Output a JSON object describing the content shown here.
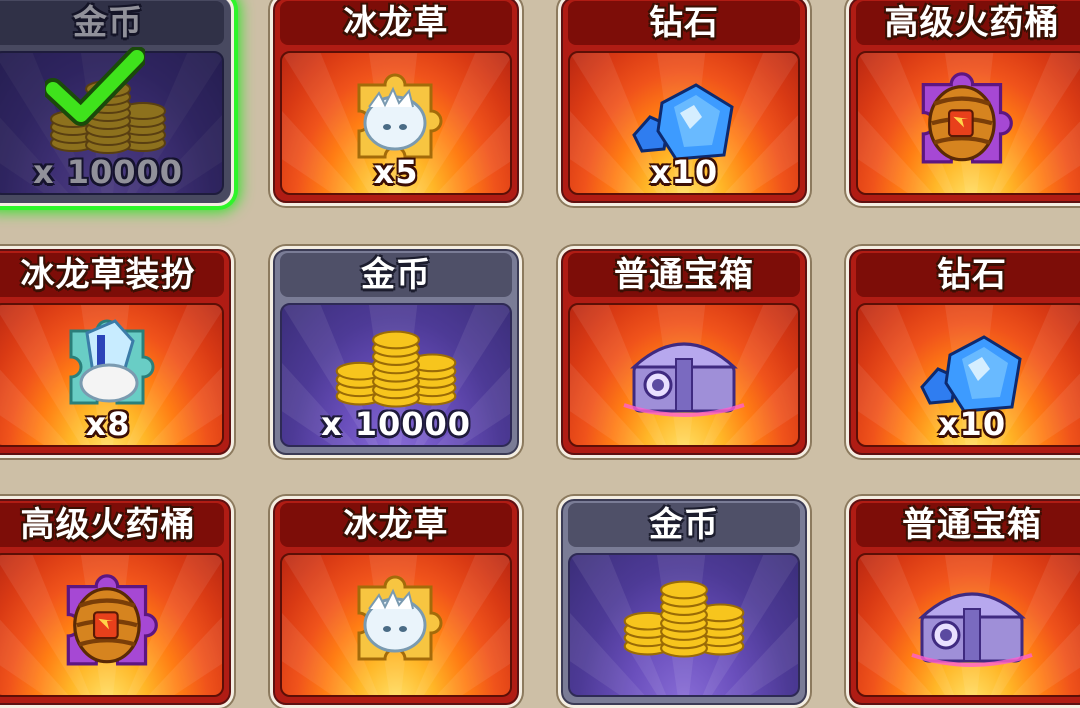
{
  "colors": {
    "background": "#cdbfa6",
    "card_red": "#b01c14",
    "card_gray": "#7a7c96",
    "claimed_glow": "#2ff52a"
  },
  "rewards": [
    {
      "title": "金币",
      "count": "x 10000",
      "icon": "gold-coins-icon",
      "style": "gray",
      "claimed": true
    },
    {
      "title": "冰龙草",
      "count": "x5",
      "icon": "ice-dragon-grass-puzzle-icon",
      "style": "red",
      "claimed": false
    },
    {
      "title": "钻石",
      "count": "x10",
      "icon": "diamond-icon",
      "style": "red",
      "claimed": false
    },
    {
      "title": "高级火药桶",
      "count": "",
      "icon": "powder-keg-puzzle-icon",
      "style": "red",
      "claimed": false
    },
    {
      "title": "冰龙草装扮",
      "count": "x8",
      "icon": "ice-dragon-costume-puzzle-icon",
      "style": "red",
      "claimed": false
    },
    {
      "title": "金币",
      "count": "x 10000",
      "icon": "gold-coins-icon",
      "style": "gray",
      "claimed": false
    },
    {
      "title": "普通宝箱",
      "count": "",
      "icon": "treasure-chest-icon",
      "style": "red",
      "claimed": false
    },
    {
      "title": "钻石",
      "count": "x10",
      "icon": "diamond-icon",
      "style": "red",
      "claimed": false
    },
    {
      "title": "高级火药桶",
      "count": "",
      "icon": "powder-keg-puzzle-icon",
      "style": "red",
      "claimed": false
    },
    {
      "title": "冰龙草",
      "count": "",
      "icon": "ice-dragon-grass-puzzle-icon",
      "style": "red",
      "claimed": false
    },
    {
      "title": "金币",
      "count": "",
      "icon": "gold-coins-icon",
      "style": "gray",
      "claimed": false
    },
    {
      "title": "普通宝箱",
      "count": "",
      "icon": "treasure-chest-icon",
      "style": "red",
      "claimed": false
    }
  ]
}
